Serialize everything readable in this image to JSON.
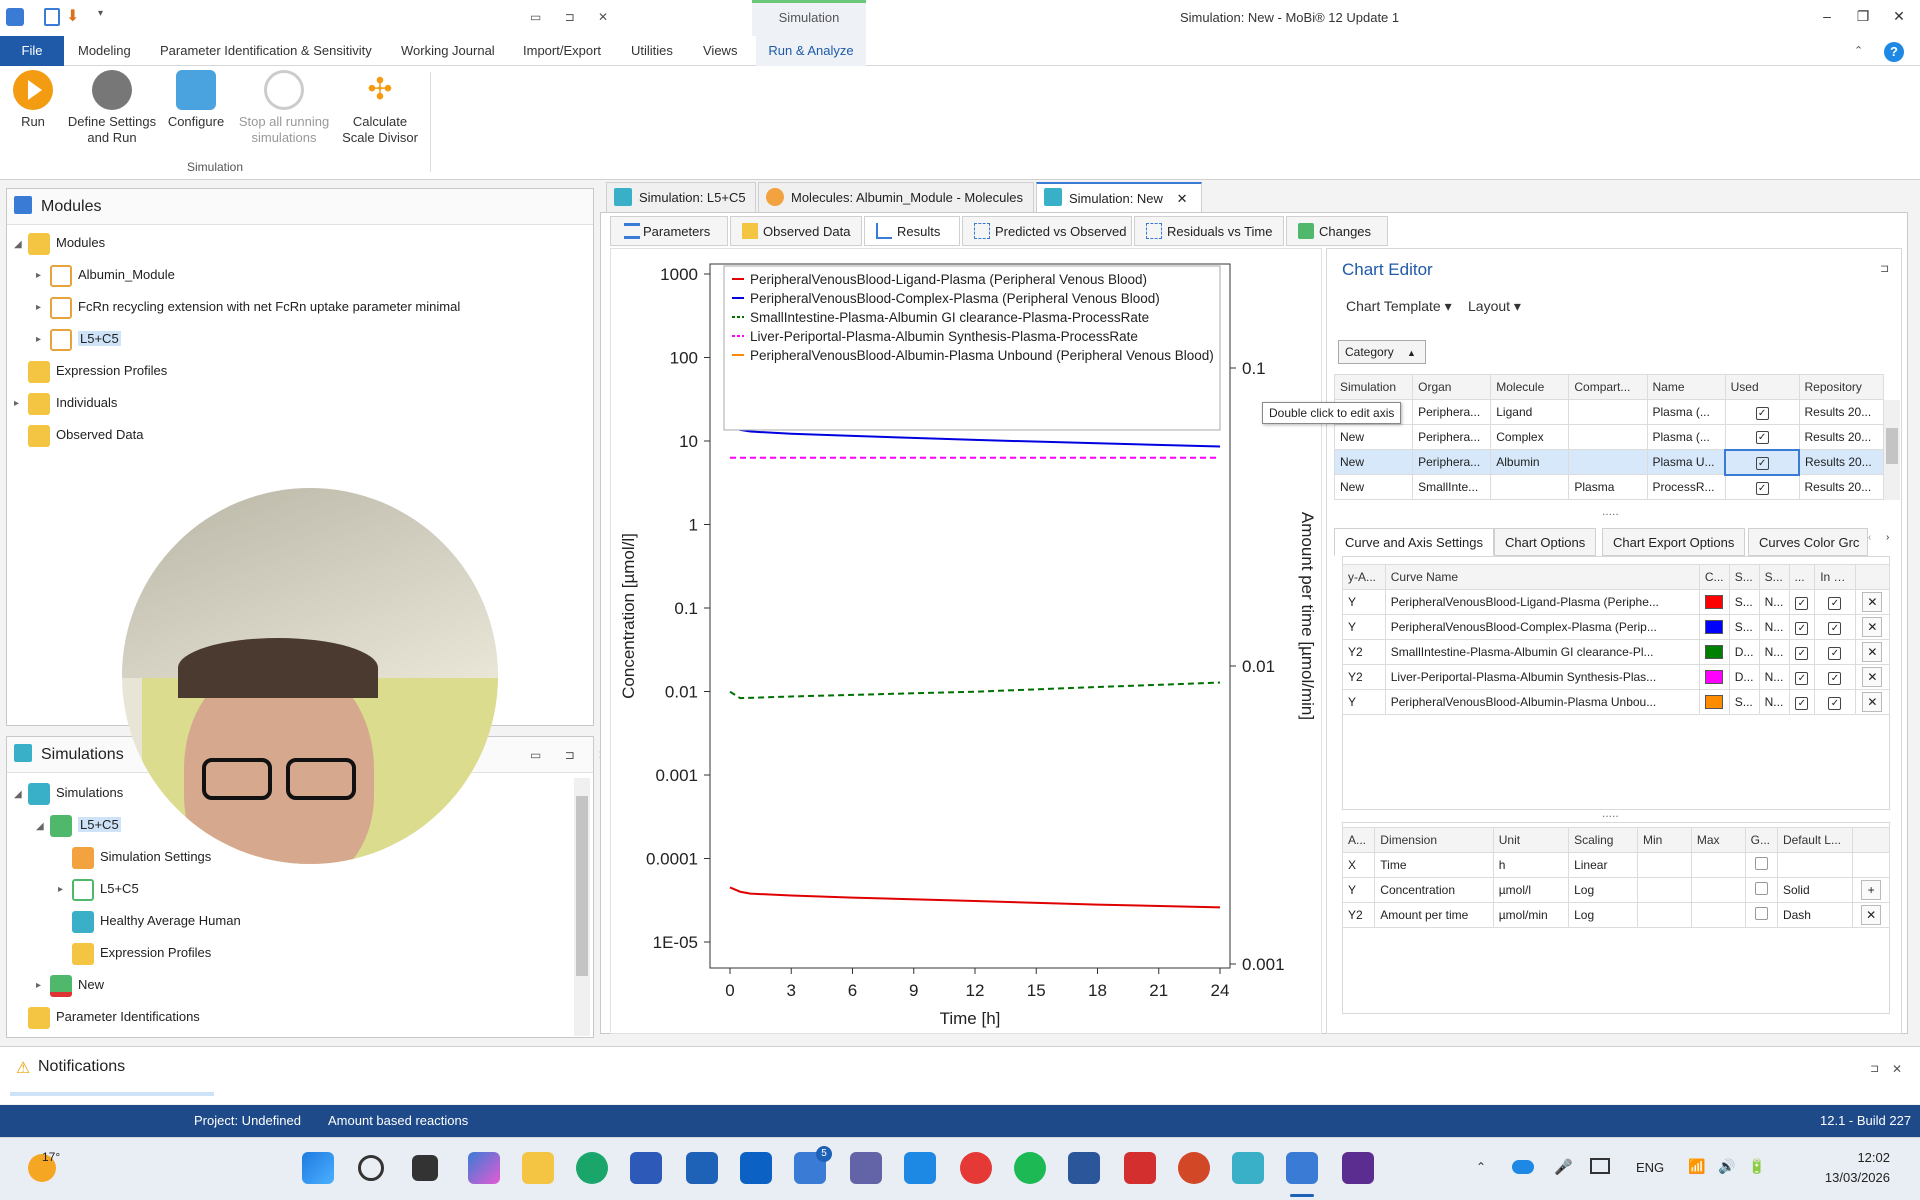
{
  "window": {
    "title": "Simulation: New - MoBi® 12 Update 1",
    "context_tab": "Simulation",
    "minimize": "–",
    "restore": "❐",
    "close": "✕"
  },
  "menu": {
    "file": "File",
    "items": [
      "Modeling",
      "Parameter Identification & Sensitivity",
      "Working Journal",
      "Import/Export",
      "Utilities",
      "Views",
      "Run & Analyze"
    ],
    "help": "?"
  },
  "ribbon": {
    "buttons": [
      {
        "label": "Run"
      },
      {
        "label": "Define Settings and Run"
      },
      {
        "label": "Configure"
      },
      {
        "label": "Stop all running simulations"
      },
      {
        "label": "Calculate Scale Divisor"
      }
    ],
    "group_label": "Simulation"
  },
  "modules_panel": {
    "title": "Modules",
    "items": [
      "Modules",
      "Albumin_Module",
      "FcRn recycling extension with net FcRn uptake parameter minimal",
      "L5+C5",
      "Expression Profiles",
      "Individuals",
      "Observed Data"
    ]
  },
  "simulations_panel": {
    "title": "Simulations",
    "items": [
      "Simulations",
      "L5+C5",
      "Simulation Settings",
      "L5+C5",
      "Healthy Average Human",
      "Expression Profiles",
      "New",
      "Parameter Identifications"
    ]
  },
  "document_tabs": [
    "Simulation: L5+C5",
    "Molecules: Albumin_Module - Molecules",
    "Simulation: New"
  ],
  "document_tab_close": "✕",
  "sub_tabs": [
    "Parameters",
    "Observed Data",
    "Results",
    "Predicted vs Observed",
    "Residuals vs Time",
    "Changes"
  ],
  "chart": {
    "tooltip": "Double click to edit axis",
    "xlabel": "Time [h]",
    "ylabel": "Concentration [µmol/l]",
    "y2label": "Amount per time [µmol/min]",
    "xticks": [
      "0",
      "3",
      "6",
      "9",
      "12",
      "15",
      "18",
      "21",
      "24"
    ],
    "yticks": [
      "1000",
      "100",
      "10",
      "1",
      "0.1",
      "0.01",
      "0.001",
      "0.0001",
      "1E-05"
    ],
    "y2ticks": [
      "0.1",
      "0.01",
      "0.001"
    ],
    "legend": [
      {
        "label": "PeripheralVenousBlood-Ligand-Plasma  (Peripheral  Venous  Blood)",
        "color": "#e00000",
        "dash": false
      },
      {
        "label": "PeripheralVenousBlood-Complex-Plasma  (Peripheral  Venous  Blood)",
        "color": "#0000e0",
        "dash": false
      },
      {
        "label": "SmallIntestine-Plasma-Albumin  GI  clearance-Plasma-ProcessRate",
        "color": "#007000",
        "dash": true
      },
      {
        "label": "Liver-Periportal-Plasma-Albumin  Synthesis-Plasma-ProcessRate",
        "color": "#ff00ff",
        "dash": true
      },
      {
        "label": "PeripheralVenousBlood-Albumin-Plasma  Unbound  (Peripheral  Venous  Blood)",
        "color": "#ff8c00",
        "dash": false
      }
    ]
  },
  "chart_data": {
    "type": "line",
    "xlabel": "Time [h]",
    "ylabel": "Concentration [µmol/l]",
    "y2label": "Amount per time [µmol/min]",
    "xlim": [
      0,
      24
    ],
    "ylim": [
      1e-05,
      1000
    ],
    "y2lim": [
      0.001,
      0.1
    ],
    "yscale": "log",
    "y2scale": "log",
    "legend_position": "top",
    "series": [
      {
        "name": "PeripheralVenousBlood-Ligand-Plasma (Peripheral Venous Blood)",
        "axis": "Y",
        "color": "#e00000",
        "x": [
          0,
          0.5,
          1,
          3,
          6,
          12,
          18,
          24
        ],
        "y": [
          4.5e-05,
          4e-05,
          3.8e-05,
          3.6e-05,
          3.4e-05,
          3.1e-05,
          2.8e-05,
          2.6e-05
        ]
      },
      {
        "name": "PeripheralVenousBlood-Complex-Plasma (Peripheral Venous Blood)",
        "axis": "Y",
        "color": "#0000e0",
        "x": [
          0,
          0.5,
          1,
          3,
          6,
          12,
          18,
          24
        ],
        "y": [
          15,
          13.6,
          13,
          12.2,
          11.5,
          10.3,
          9.4,
          8.6
        ]
      },
      {
        "name": "SmallIntestine-Plasma-Albumin GI clearance-Plasma-ProcessRate",
        "axis": "Y2",
        "color": "#007000",
        "x": [
          0,
          0.5,
          3,
          6,
          12,
          18,
          24
        ],
        "y": [
          0.0082,
          0.0078,
          0.0079,
          0.008,
          0.0082,
          0.0085,
          0.0088
        ]
      },
      {
        "name": "Liver-Periportal-Plasma-Albumin Synthesis-Plasma-ProcessRate",
        "axis": "Y2",
        "color": "#ff00ff",
        "x": [
          0,
          6,
          12,
          18,
          24
        ],
        "y": [
          0.05,
          0.05,
          0.05,
          0.05,
          0.05
        ]
      },
      {
        "name": "PeripheralVenousBlood-Albumin-Plasma Unbound (Peripheral Venous Blood)",
        "axis": "Y",
        "color": "#ff8c00",
        "x": [],
        "y": []
      }
    ]
  },
  "chart_editor": {
    "title": "Chart Editor",
    "chart_template": "Chart Template",
    "layout": "Layout",
    "category": "Category",
    "data_columns": [
      "Simulation",
      "Organ",
      "Molecule",
      "Compart...",
      "Name",
      "Used",
      "Repository"
    ],
    "data_rows": [
      [
        "",
        "Periphera...",
        "Ligand",
        "",
        "Plasma (...",
        "✓",
        "Results 20..."
      ],
      [
        "New",
        "Periphera...",
        "Complex",
        "",
        "Plasma (...",
        "✓",
        "Results 20..."
      ],
      [
        "New",
        "Periphera...",
        "Albumin",
        "",
        "Plasma U...",
        "✓",
        "Results 20..."
      ],
      [
        "New",
        "SmallInte...",
        "",
        "Plasma",
        "ProcessR...",
        "✓",
        "Results 20..."
      ]
    ],
    "settings_tabs": [
      "Curve and Axis Settings",
      "Chart Options",
      "Chart Export Options",
      "Curves Color Grc"
    ],
    "curve_columns": [
      "y-A...",
      "Curve Name",
      "C...",
      "S...",
      "S...",
      "...",
      "In L..."
    ],
    "curves": [
      {
        "axis": "Y",
        "name": "PeripheralVenousBlood-Ligand-Plasma (Periphe...",
        "color": "#ff0000",
        "style": "S...",
        "symbol": "N..."
      },
      {
        "axis": "Y",
        "name": "PeripheralVenousBlood-Complex-Plasma (Perip...",
        "color": "#0000ff",
        "style": "S...",
        "symbol": "N..."
      },
      {
        "axis": "Y2",
        "name": "SmallIntestine-Plasma-Albumin GI clearance-Pl...",
        "color": "#008000",
        "style": "D...",
        "symbol": "N..."
      },
      {
        "axis": "Y2",
        "name": "Liver-Periportal-Plasma-Albumin Synthesis-Plas...",
        "color": "#ff00ff",
        "style": "D...",
        "symbol": "N..."
      },
      {
        "axis": "Y",
        "name": "PeripheralVenousBlood-Albumin-Plasma Unbou...",
        "color": "#ff8c00",
        "style": "S...",
        "symbol": "N..."
      }
    ],
    "axis_columns": [
      "A...",
      "Dimension",
      "Unit",
      "Scaling",
      "Min",
      "Max",
      "G...",
      "Default L..."
    ],
    "axes": [
      {
        "axis": "X",
        "dimension": "Time",
        "unit": "h",
        "scaling": "Linear",
        "default": ""
      },
      {
        "axis": "Y",
        "dimension": "Concentration",
        "unit": "µmol/l",
        "scaling": "Log",
        "default": "Solid"
      },
      {
        "axis": "Y2",
        "dimension": "Amount per time",
        "unit": "µmol/min",
        "scaling": "Log",
        "default": "Dash"
      }
    ],
    "add": "+",
    "remove": "✕",
    "splitter": "....."
  },
  "notifications": {
    "title": "Notifications"
  },
  "status": {
    "project": "Project: Undefined",
    "mode": "Amount based reactions",
    "build": "12.1 - Build 227"
  },
  "taskbar": {
    "weather": "17°",
    "lang": "ENG",
    "time": "12:02",
    "date": "13/03/2026",
    "badge": "5"
  }
}
